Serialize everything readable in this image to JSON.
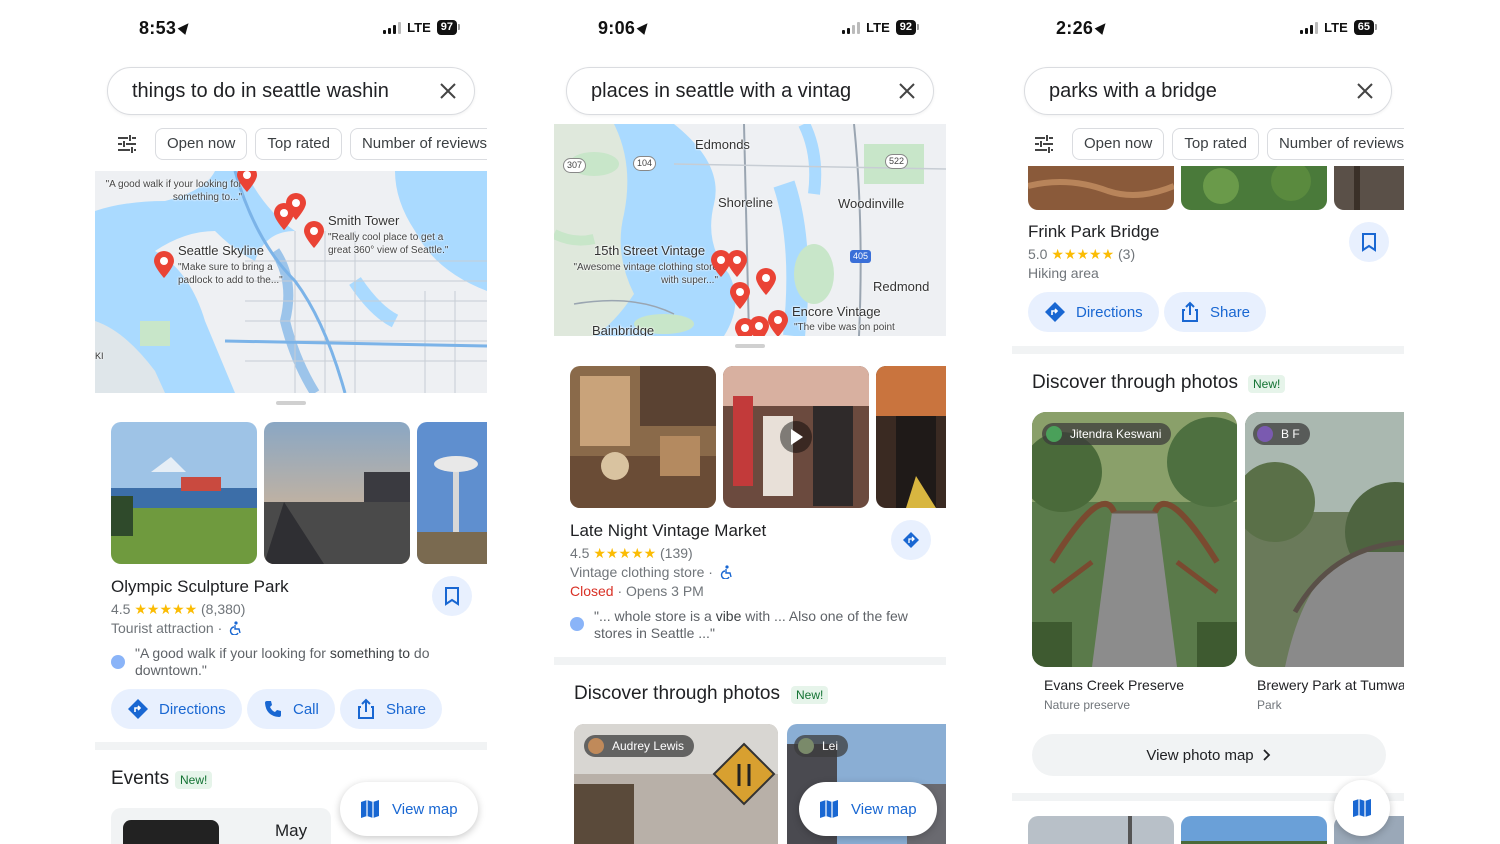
{
  "screens": [
    {
      "status": {
        "time": "8:53",
        "network": "LTE",
        "battery": "97"
      },
      "search": {
        "query": "things to do in seattle washin"
      },
      "chips": [
        "Open now",
        "Top rated",
        "Number of reviews"
      ],
      "map": {
        "labels": {
          "smith_tower": "Smith Tower",
          "smith_tower_quote": "\"Really cool place to get a great 360° view of Seattle.\"",
          "skyline": "Seattle Skyline",
          "skyline_quote": "\"Make sure to bring a padlock to add to the...\"",
          "walk_quote": "\"A good walk if your looking for something to...\"",
          "edge": "KI"
        }
      },
      "place": {
        "name": "Olympic Sculpture Park",
        "rating": "4.5",
        "stars": "★★★★★",
        "reviews": "(8,380)",
        "category": "Tourist attraction ·",
        "review_plain": "\"A good walk if your looking for ",
        "review_bold": "something to",
        "review_tail": " do downtown.\""
      },
      "actions": {
        "directions": "Directions",
        "call": "Call",
        "share": "Share"
      },
      "section": {
        "title": "Events",
        "badge": "New!"
      },
      "view_map": "View map",
      "event_month": "May"
    },
    {
      "status": {
        "time": "9:06",
        "network": "LTE",
        "battery": "92"
      },
      "search": {
        "query": "places in seattle with a vintag"
      },
      "map": {
        "labels": {
          "edmonds": "Edmonds",
          "shoreline": "Shoreline",
          "woodinville": "Woodinville",
          "redmond": "Redmond",
          "bainbridge": "Bainbridge",
          "fifteenth": "15th Street Vintage",
          "fifteenth_quote": "\"Awesome vintage clothing store with super...\"",
          "encore": "Encore Vintage",
          "encore_quote": "\"The vibe was on point",
          "r307": "307",
          "r104": "104",
          "r522": "522",
          "r405": "405"
        }
      },
      "place": {
        "name": "Late Night Vintage Market",
        "rating": "4.5",
        "stars": "★★★★★",
        "reviews": "(139)",
        "category": "Vintage clothing store ·",
        "status": "Closed",
        "hours": " · Opens 3 PM",
        "review_plain": "\"... whole store is a ",
        "review_bold": "vibe",
        "review_tail": " with ... Also one of the few stores in Seattle ...\""
      },
      "section": {
        "title": "Discover through photos",
        "badge": "New!"
      },
      "credits": [
        "Audrey Lewis",
        "Lei"
      ],
      "view_map": "View map"
    },
    {
      "status": {
        "time": "2:26",
        "network": "LTE",
        "battery": "65"
      },
      "search": {
        "query": "parks with a bridge"
      },
      "chips": [
        "Open now",
        "Top rated",
        "Number of reviews"
      ],
      "place": {
        "name": "Frink Park Bridge",
        "rating": "5.0",
        "stars": "★★★★★",
        "reviews": "(3)",
        "category": "Hiking area"
      },
      "actions": {
        "directions": "Directions",
        "share": "Share"
      },
      "section": {
        "title": "Discover through photos",
        "badge": "New!"
      },
      "photos": [
        {
          "credit": "Jitendra Keswani",
          "name": "Evans Creek Preserve",
          "type": "Nature preserve"
        },
        {
          "credit": "B F",
          "name": "Brewery Park at Tumwa",
          "type": "Park"
        }
      ],
      "photo_map_btn": "View photo map"
    }
  ],
  "colors": {
    "accent": "#1967d2",
    "pin": "#ea4335",
    "star": "#fbbc04",
    "closed": "#d93025",
    "water": "#aadaff",
    "land": "#f1f3f4",
    "park": "#c8e6c9"
  }
}
